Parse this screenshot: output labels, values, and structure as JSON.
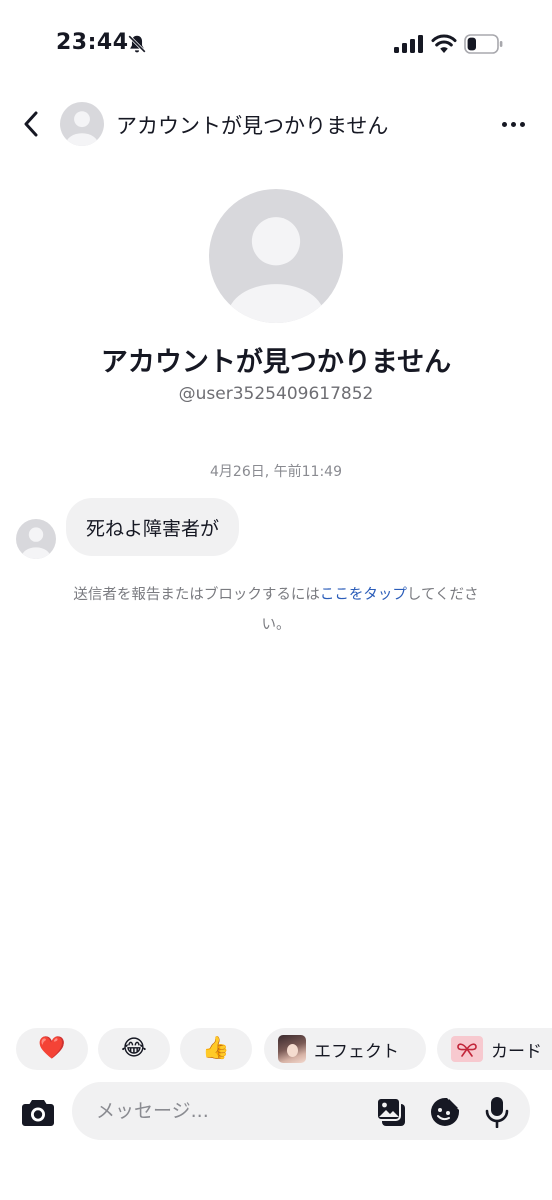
{
  "status_bar": {
    "time": "23:44",
    "icons": [
      "bell-slash-icon",
      "signal-icon",
      "wifi-icon",
      "battery-icon"
    ],
    "battery_level": 0.3
  },
  "header": {
    "back_icon": "chevron-left-icon",
    "title": "アカウントが見つかりません",
    "more_icon": "more-icon"
  },
  "profile": {
    "name": "アカウントが見つかりません",
    "handle": "@user3525409617852"
  },
  "conversation": {
    "timestamp": "4月26日, 午前11:49",
    "messages": [
      {
        "sender": "other",
        "text": "死ねよ障害者が"
      }
    ],
    "report_notice": {
      "prefix": "送信者を報告またはブロックするには",
      "link": "ここをタップ",
      "suffix": "してください。"
    }
  },
  "quick_reactions": {
    "items": [
      {
        "emoji": "❤️",
        "icon": "heart-icon"
      },
      {
        "emoji": "😂",
        "icon": "laughing-face-icon"
      },
      {
        "emoji": "👍",
        "icon": "thumbs-up-icon"
      }
    ],
    "effect_label": "エフェクト",
    "card_label": "カード"
  },
  "composer": {
    "placeholder": "メッセージ...",
    "icons": [
      "camera-icon",
      "gallery-icon",
      "sticker-icon",
      "microphone-icon"
    ]
  },
  "colors": {
    "text": "#161823",
    "secondary_text": "#6e6e73",
    "link": "#2b5db9",
    "bubble": "#f1f1f2",
    "avatar_placeholder": "#d8d8dc",
    "heart": "#e8173a"
  }
}
